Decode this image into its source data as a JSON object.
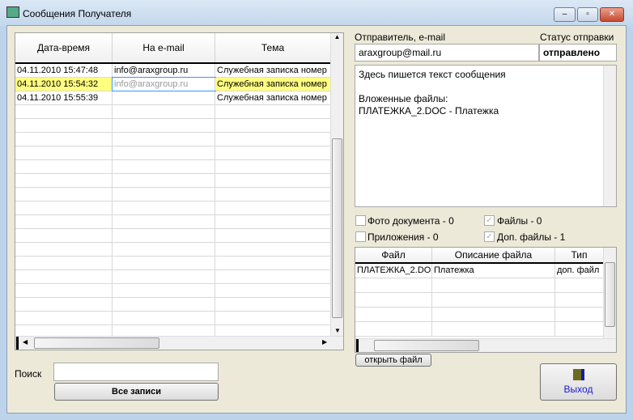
{
  "window": {
    "title": "Сообщения Получателя",
    "minimize": "–",
    "maximize": "▫",
    "close": "✕"
  },
  "messages": {
    "columns": [
      "Дата-время",
      "На e-mail",
      "Тема"
    ],
    "rows": [
      [
        "04.11.2010 15:47:48",
        "info@araxgroup.ru",
        "Служебная записка номер"
      ],
      [
        "04.11.2010 15:54:32",
        "info@araxgroup.ru",
        "Служебная записка номер"
      ],
      [
        "04.11.2010 15:55:39",
        "",
        "Служебная записка номер"
      ]
    ],
    "selected_row": 1
  },
  "sender": {
    "label": "Отправитель, e-mail",
    "value": "araxgroup@mail.ru"
  },
  "status": {
    "label": "Статус отправки",
    "value": "отправлено"
  },
  "body_text": "Здесь пишется текст сообщения\n\nВложенные файлы:\nПЛАТЕЖКА_2.DOC - Платежка",
  "checks": [
    {
      "label": "Фото документа - 0",
      "checked": false
    },
    {
      "label": "Файлы - 0",
      "checked": true
    },
    {
      "label": "Приложения - 0",
      "checked": false
    },
    {
      "label": "Доп. файлы - 1",
      "checked": true
    }
  ],
  "files": {
    "columns": [
      "Файл",
      "Описание файла",
      "Тип"
    ],
    "rows": [
      [
        "ПЛАТЕЖКА_2.DOC",
        "Платежка",
        "доп. файл"
      ]
    ]
  },
  "open_file_label": "открыть файл",
  "search": {
    "label": "Поиск",
    "value": ""
  },
  "all_records_label": "Все записи",
  "exit_label": "Выход"
}
